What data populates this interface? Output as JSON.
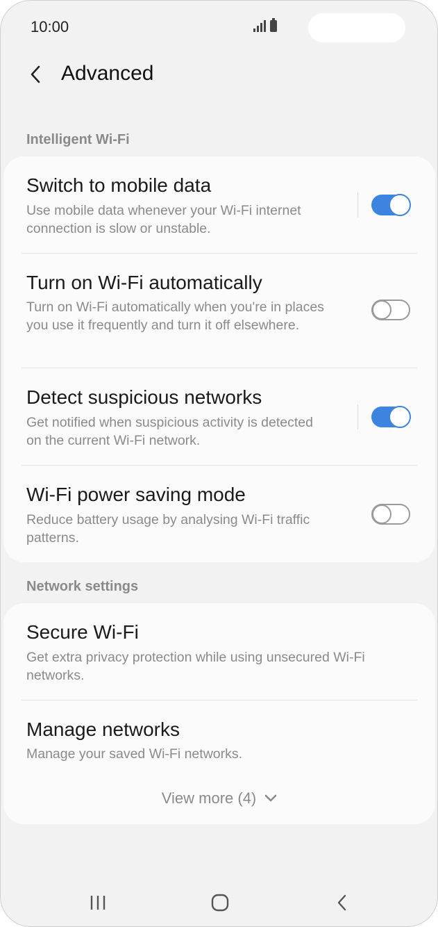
{
  "status_bar": {
    "time": "10:00",
    "icons": [
      "signal-icon",
      "battery-icon"
    ]
  },
  "header": {
    "title": "Advanced",
    "back_icon": "chevron-left-icon"
  },
  "colors": {
    "accent": "#3d84e0",
    "background": "#f2f2f2",
    "card": "#fbfbfb",
    "secondary_text": "#8a8a8a"
  },
  "intelligent_wifi": {
    "section_label": "Intelligent Wi-Fi",
    "items": [
      {
        "title": "Switch to mobile data",
        "subtitle": "Use mobile data whenever your Wi-Fi internet connection is slow or unstable.",
        "toggle_on": true
      },
      {
        "title": "Turn on Wi-Fi automatically",
        "subtitle": "Turn on Wi-Fi automatically when you're in places you use it frequently and turn it off elsewhere.",
        "toggle_on": false
      },
      {
        "title": "Detect suspicious networks",
        "subtitle": "Get notified when suspicious activity is detected on the current Wi-Fi network.",
        "toggle_on": true
      },
      {
        "title": "Wi-Fi power saving mode",
        "subtitle": "Reduce battery usage by analysing Wi-Fi traffic patterns.",
        "toggle_on": false
      }
    ]
  },
  "network_settings": {
    "section_label": "Network settings",
    "items": [
      {
        "title": "Secure Wi-Fi",
        "subtitle": "Get extra privacy protection while using unsecured Wi-Fi networks."
      },
      {
        "title": "Manage networks",
        "subtitle": "Manage your saved Wi-Fi networks."
      }
    ],
    "view_more": "View more (4)"
  },
  "nav_bar": {
    "icons": [
      "recent-apps-icon",
      "home-icon",
      "back-icon"
    ]
  }
}
